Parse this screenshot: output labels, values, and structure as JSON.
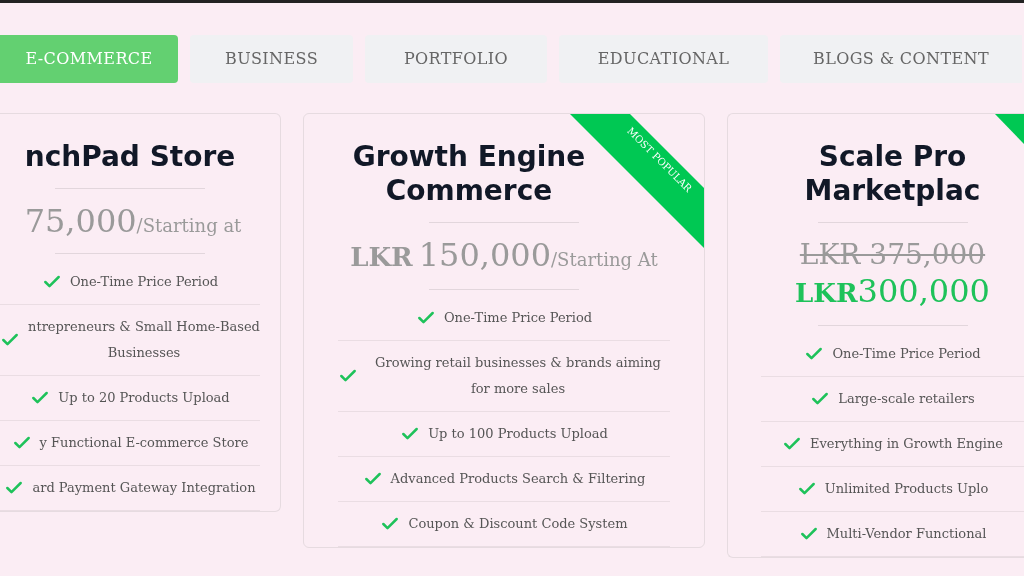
{
  "tabs": [
    {
      "label": "E-COMMERCE",
      "selected": true
    },
    {
      "label": "BUSINESS",
      "selected": false
    },
    {
      "label": "PORTFOLIO",
      "selected": false
    },
    {
      "label": "EDUCATIONAL",
      "selected": false
    },
    {
      "label": "BLOGS & CONTENT",
      "selected": false
    }
  ],
  "plans": [
    {
      "title": "nchPad Store",
      "featured": false,
      "price": {
        "amount": "75,000",
        "suffix": "/Starting at"
      },
      "features": [
        "One-Time Price Period",
        "ntrepreneurs & Small Home-Based Businesses",
        "Up to 20 Products Upload",
        "y Functional E-commerce Store",
        "ard Payment Gateway Integration"
      ]
    },
    {
      "title": "Growth Engine Commerce",
      "featured": true,
      "ribbon": "MOST POPULAR",
      "price": {
        "currency": "LKR",
        "amount": "150,000",
        "suffix": "/Starting At"
      },
      "features": [
        "One-Time Price Period",
        "Growing retail businesses & brands aiming for more sales",
        "Up to 100 Products Upload",
        "Advanced Products Search & Filtering",
        "Coupon & Discount Code System"
      ]
    },
    {
      "title": "Scale Pro Marketplac",
      "featured": true,
      "old_price": "LKR 375,000",
      "price": {
        "currency": "LKR",
        "amount": "300,000"
      },
      "features": [
        "One-Time Price Period",
        "Large-scale retailers",
        "Everything in Growth Engine",
        "Unlimited Products Uplo",
        "Multi-Vendor Functional"
      ]
    }
  ]
}
